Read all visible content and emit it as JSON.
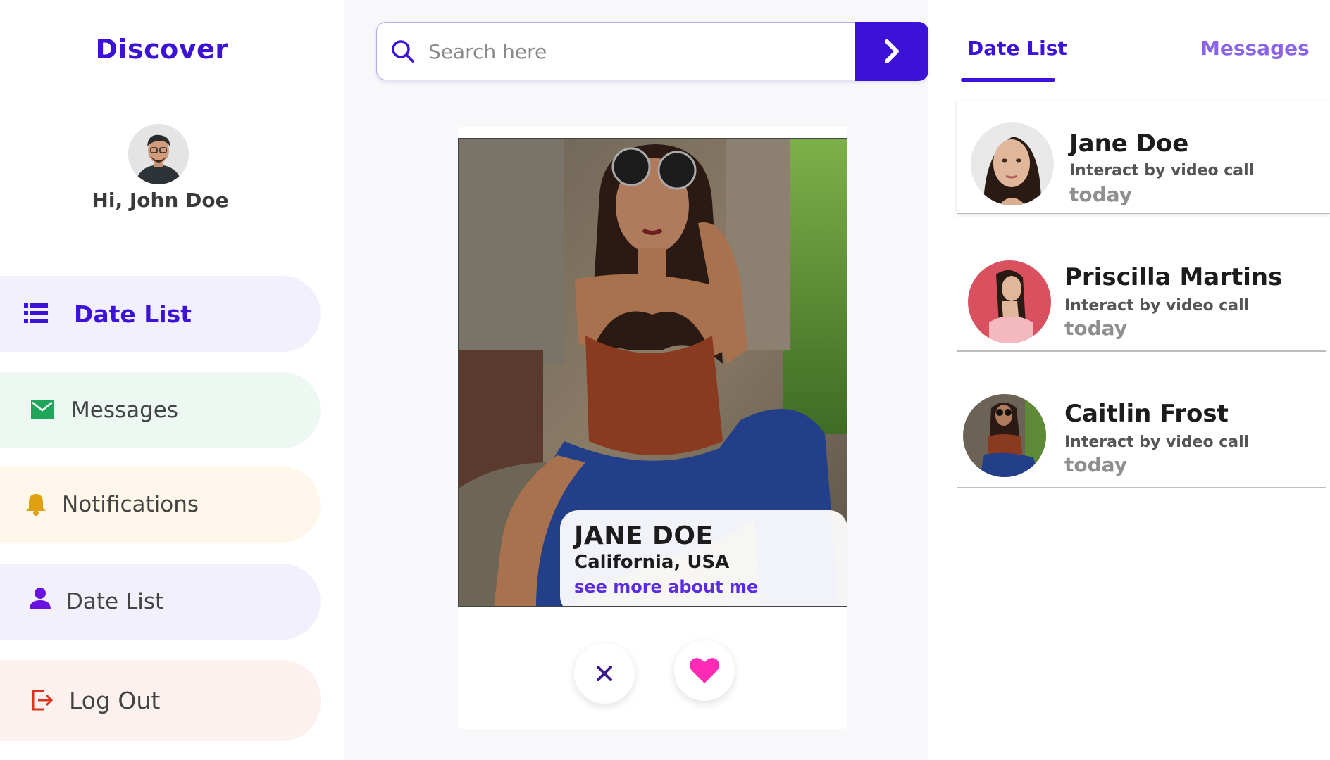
{
  "sidebar": {
    "brand": "Discover",
    "greeting": "Hi, John Doe",
    "items": [
      {
        "label": "Date List",
        "icon": "list-icon",
        "active": true
      },
      {
        "label": "Messages",
        "icon": "envelope-icon"
      },
      {
        "label": "Notifications",
        "icon": "bell-icon"
      },
      {
        "label": "Date List",
        "icon": "user-icon"
      },
      {
        "label": "Log Out",
        "icon": "logout-icon"
      }
    ]
  },
  "search": {
    "placeholder": "Search here",
    "value": ""
  },
  "card": {
    "name": "JANE DOE",
    "location": "California, USA",
    "more_link": "see more about me"
  },
  "right_panel": {
    "tabs": [
      {
        "label": "Date List",
        "active": true
      },
      {
        "label": "Messages",
        "active": false
      }
    ],
    "matches": [
      {
        "name": "Jane Doe",
        "subtitle": "Interact by video call",
        "time": "today"
      },
      {
        "name": "Priscilla Martins",
        "subtitle": "Interact by video call",
        "time": "today"
      },
      {
        "name": "Caitlin Frost",
        "subtitle": "Interact by video call",
        "time": "today"
      }
    ]
  },
  "colors": {
    "brand": "#3b12d6",
    "like": "#ff2bb4",
    "reject": "#3a1a8a",
    "messages_icon": "#1fa65a",
    "bell_icon": "#e0a010",
    "logout_icon": "#d9331f"
  }
}
